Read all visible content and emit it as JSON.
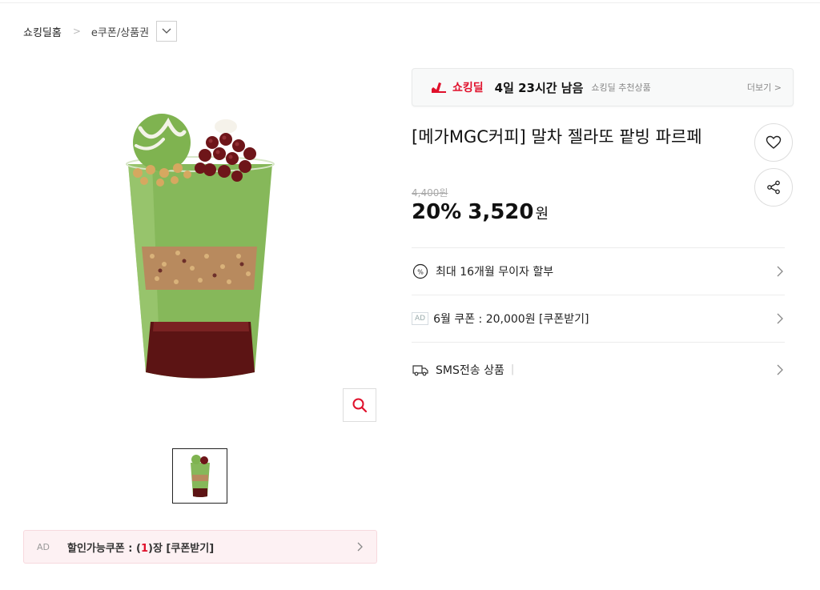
{
  "breadcrumb": {
    "home": "쇼킹딜홈",
    "separator": ">",
    "category": "e쿠폰/상품권"
  },
  "deal": {
    "logo": "쇼킹딜",
    "time_left": "4일 23시간 남음",
    "recommend": "쇼킹딜 추천상품",
    "more": "더보기 >"
  },
  "product": {
    "title": "[메가MGC커피] 말차 젤라또 팥빙 파르페",
    "original_price": "4,400원",
    "discount": "20%",
    "price": "3,520",
    "currency": "원"
  },
  "info_rows": [
    {
      "label": "최대 16개월 무이자 할부"
    },
    {
      "ad": "AD",
      "label": "6월 쿠폰 : 20,000원 [쿠폰받기]"
    },
    {
      "label": "SMS전송 상품",
      "divider": "|"
    }
  ],
  "coupon_bar": {
    "ad": "AD",
    "prefix": "할인가능쿠폰 : (",
    "count": "1",
    "suffix": ")장 [쿠폰받기]"
  },
  "colors": {
    "accent": "#e0102b",
    "matcha": "#8dbb5e",
    "redbean": "#6b1a1a"
  }
}
